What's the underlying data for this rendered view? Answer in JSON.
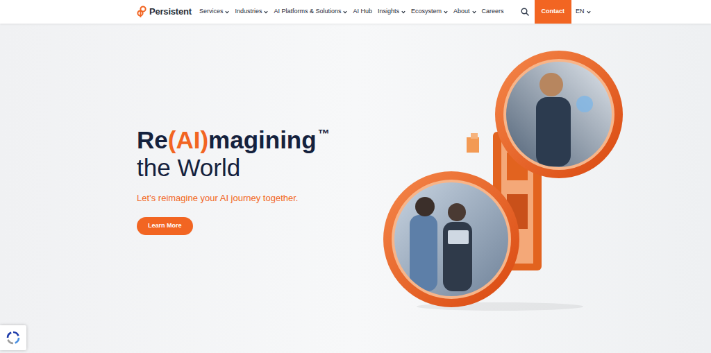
{
  "nav": {
    "logo": "Persistent",
    "items": [
      {
        "label": "Services",
        "dropdown": true
      },
      {
        "label": "Industries",
        "dropdown": true
      },
      {
        "label": "AI Platforms & Solutions",
        "dropdown": true
      },
      {
        "label": "AI Hub",
        "dropdown": false
      },
      {
        "label": "Insights",
        "dropdown": true
      },
      {
        "label": "Ecosystem",
        "dropdown": true
      },
      {
        "label": "About",
        "dropdown": true
      },
      {
        "label": "Careers",
        "dropdown": false
      }
    ],
    "contact": "Contact",
    "language": {
      "label": "EN",
      "dropdown": true
    }
  },
  "hero": {
    "headline": [
      {
        "text": "Re",
        "color": "#14213d",
        "kind": "word"
      },
      {
        "text": "(AI)",
        "color": "#f26522",
        "kind": "word"
      },
      {
        "text": "magining",
        "color": "#14213d",
        "kind": "word"
      },
      {
        "text": "™",
        "color": "#14213d",
        "kind": "superscript"
      }
    ],
    "subline": "the World",
    "tagline": "Let’s reimagine your AI journey together.",
    "button": "Learn More"
  }
}
